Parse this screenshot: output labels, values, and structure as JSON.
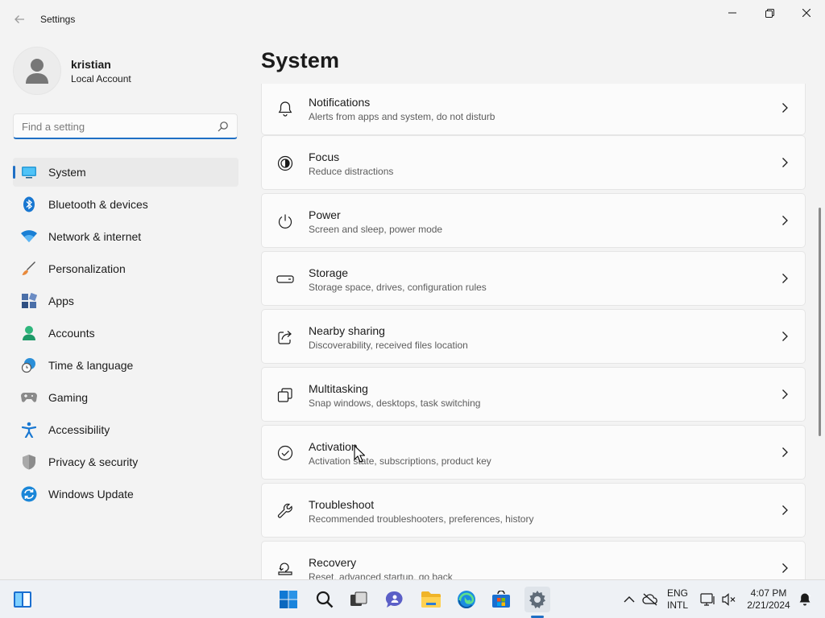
{
  "window": {
    "title": "Settings"
  },
  "profile": {
    "name": "kristian",
    "account_type": "Local Account"
  },
  "search": {
    "placeholder": "Find a setting"
  },
  "sidebar": {
    "items": [
      {
        "label": "System",
        "icon": "system-icon",
        "active": true
      },
      {
        "label": "Bluetooth & devices",
        "icon": "bluetooth-icon"
      },
      {
        "label": "Network & internet",
        "icon": "wifi-icon"
      },
      {
        "label": "Personalization",
        "icon": "brush-icon"
      },
      {
        "label": "Apps",
        "icon": "apps-icon"
      },
      {
        "label": "Accounts",
        "icon": "accounts-icon"
      },
      {
        "label": "Time & language",
        "icon": "globe-clock-icon"
      },
      {
        "label": "Gaming",
        "icon": "gamepad-icon"
      },
      {
        "label": "Accessibility",
        "icon": "accessibility-icon"
      },
      {
        "label": "Privacy & security",
        "icon": "shield-icon"
      },
      {
        "label": "Windows Update",
        "icon": "update-icon"
      }
    ]
  },
  "main": {
    "title": "System",
    "cards": [
      {
        "title": "Notifications",
        "description": "Alerts from apps and system, do not disturb",
        "icon": "bell-icon"
      },
      {
        "title": "Focus",
        "description": "Reduce distractions",
        "icon": "focus-icon"
      },
      {
        "title": "Power",
        "description": "Screen and sleep, power mode",
        "icon": "power-icon"
      },
      {
        "title": "Storage",
        "description": "Storage space, drives, configuration rules",
        "icon": "storage-icon"
      },
      {
        "title": "Nearby sharing",
        "description": "Discoverability, received files location",
        "icon": "share-icon"
      },
      {
        "title": "Multitasking",
        "description": "Snap windows, desktops, task switching",
        "icon": "multitasking-icon"
      },
      {
        "title": "Activation",
        "description": "Activation state, subscriptions, product key",
        "icon": "check-circle-icon"
      },
      {
        "title": "Troubleshoot",
        "description": "Recommended troubleshooters, preferences, history",
        "icon": "wrench-icon"
      },
      {
        "title": "Recovery",
        "description": "Reset, advanced startup, go back",
        "icon": "recovery-icon"
      }
    ]
  },
  "taskbar": {
    "language": "ENG",
    "layout": "INTL",
    "time": "4:07 PM",
    "date": "2/21/2024"
  },
  "colors": {
    "accent": "#1f6fc5",
    "background": "#f3f3f3",
    "card": "#fbfbfb"
  }
}
